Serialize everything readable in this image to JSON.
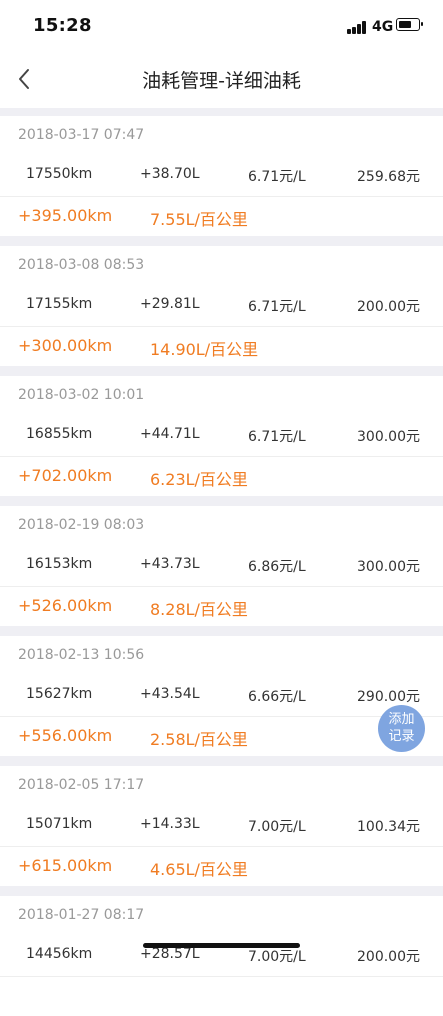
{
  "status": {
    "time": "15:28",
    "network": "4G"
  },
  "nav": {
    "title": "油耗管理-详细油耗"
  },
  "records": [
    {
      "date": "2018-03-17 07:47",
      "odometer": "17550km",
      "fuel": "+38.70L",
      "price": "6.71元/L",
      "cost": "259.68元",
      "distance": "+395.00km",
      "consumption": "7.55L/百公里"
    },
    {
      "date": "2018-03-08 08:53",
      "odometer": "17155km",
      "fuel": "+29.81L",
      "price": "6.71元/L",
      "cost": "200.00元",
      "distance": "+300.00km",
      "consumption": "14.90L/百公里"
    },
    {
      "date": "2018-03-02 10:01",
      "odometer": "16855km",
      "fuel": "+44.71L",
      "price": "6.71元/L",
      "cost": "300.00元",
      "distance": "+702.00km",
      "consumption": "6.23L/百公里"
    },
    {
      "date": "2018-02-19 08:03",
      "odometer": "16153km",
      "fuel": "+43.73L",
      "price": "6.86元/L",
      "cost": "300.00元",
      "distance": "+526.00km",
      "consumption": "8.28L/百公里"
    },
    {
      "date": "2018-02-13 10:56",
      "odometer": "15627km",
      "fuel": "+43.54L",
      "price": "6.66元/L",
      "cost": "290.00元",
      "distance": "+556.00km",
      "consumption": "2.58L/百公里"
    },
    {
      "date": "2018-02-05 17:17",
      "odometer": "15071km",
      "fuel": "+14.33L",
      "price": "7.00元/L",
      "cost": "100.34元",
      "distance": "+615.00km",
      "consumption": "4.65L/百公里"
    },
    {
      "date": "2018-01-27 08:17",
      "odometer": "14456km",
      "fuel": "+28.57L",
      "price": "7.00元/L",
      "cost": "200.00元",
      "distance": "",
      "consumption": ""
    }
  ],
  "fab": {
    "line1": "添加",
    "line2": "记录"
  },
  "colors": {
    "accent": "#f07c22",
    "fab": "#7fa5e0",
    "separator": "#efeff4"
  }
}
